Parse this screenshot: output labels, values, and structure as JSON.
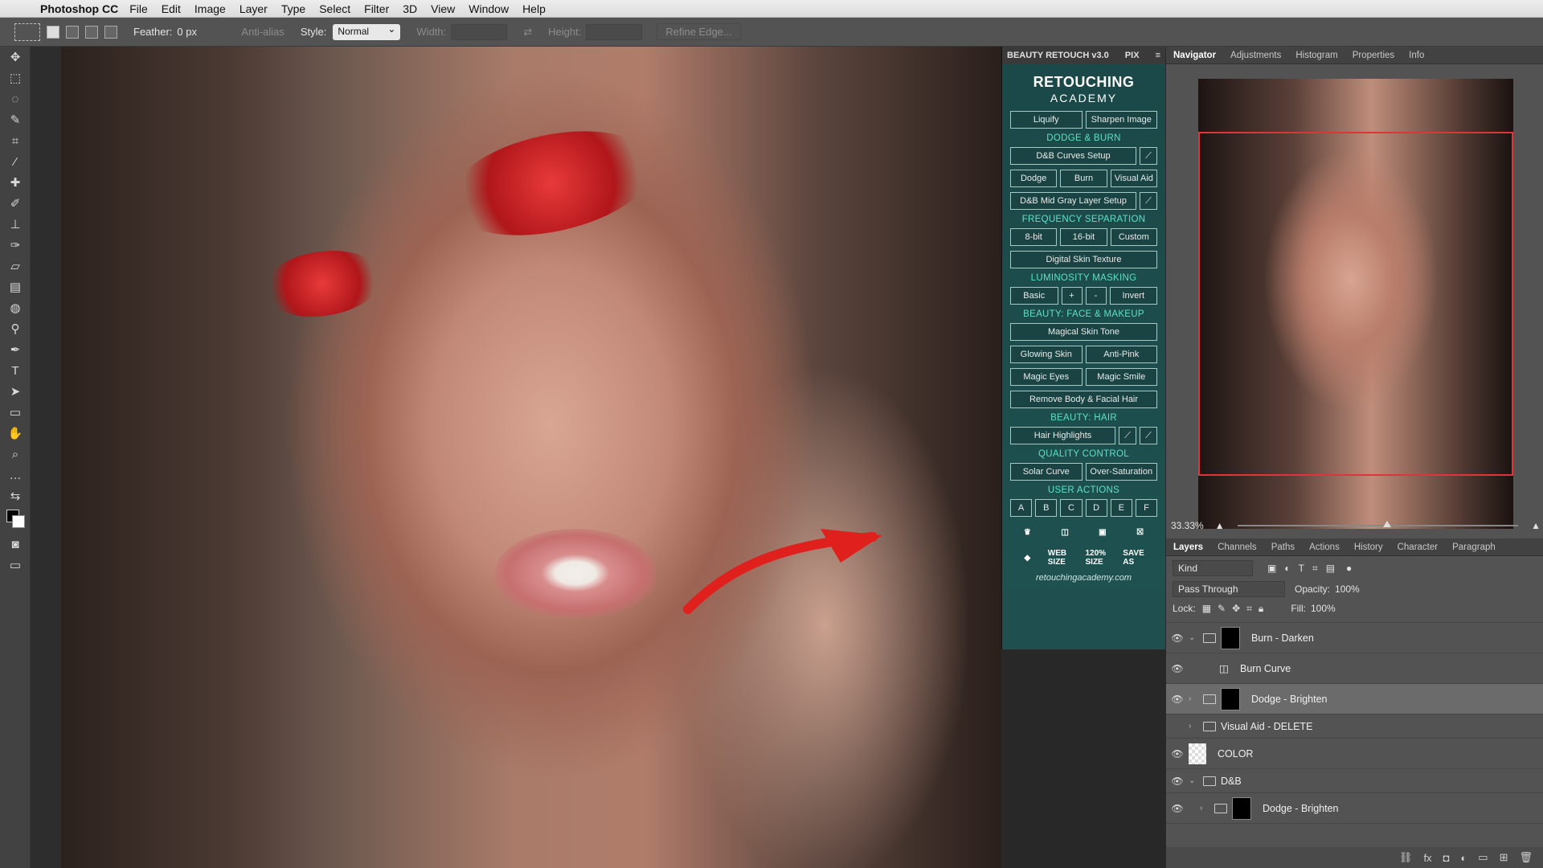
{
  "menubar": {
    "apple": "",
    "app": "Photoshop CC",
    "items": [
      "File",
      "Edit",
      "Image",
      "Layer",
      "Type",
      "Select",
      "Filter",
      "3D",
      "View",
      "Window",
      "Help"
    ]
  },
  "options": {
    "feather_label": "Feather:",
    "feather_value": "0 px",
    "antialias": "Anti-alias",
    "style_label": "Style:",
    "style_value": "Normal",
    "width_label": "Width:",
    "height_label": "Height:",
    "refine": "Refine Edge..."
  },
  "plugin": {
    "title": "BEAUTY RETOUCH v3.0",
    "pix": "PIX",
    "logo_top": "RETOUCHING",
    "logo_bottom": "ACADEMY",
    "top_buttons": [
      "Liquify",
      "Sharpen Image"
    ],
    "dodge_burn": {
      "heading": "DODGE & BURN",
      "curves": "D&B Curves Setup",
      "dodge": "Dodge",
      "burn": "Burn",
      "visual": "Visual Aid",
      "midgray": "D&B Mid Gray Layer Setup"
    },
    "freq": {
      "heading": "FREQUENCY SEPARATION",
      "b8": "8-bit",
      "b16": "16-bit",
      "custom": "Custom",
      "texture": "Digital Skin Texture"
    },
    "lum": {
      "heading": "LUMINOSITY MASKING",
      "basic": "Basic",
      "plus": "+",
      "minus": "-",
      "invert": "Invert"
    },
    "face": {
      "heading": "BEAUTY: FACE & MAKEUP",
      "skin_tone": "Magical Skin Tone",
      "glowing": "Glowing Skin",
      "antipink": "Anti-Pink",
      "eyes": "Magic Eyes",
      "smile": "Magic Smile",
      "hair_removal": "Remove Body & Facial Hair"
    },
    "hair": {
      "heading": "BEAUTY: HAIR",
      "highlights": "Hair Highlights"
    },
    "qc": {
      "heading": "QUALITY CONTROL",
      "solar": "Solar Curve",
      "oversat": "Over-Saturation"
    },
    "user": {
      "heading": "USER ACTIONS",
      "letters": [
        "A",
        "B",
        "C",
        "D",
        "E",
        "F"
      ],
      "web": "WEB SIZE",
      "size120": "120% SIZE",
      "save": "SAVE AS"
    },
    "site": "retouchingacademy.com"
  },
  "navigator": {
    "tabs": [
      "Navigator",
      "Adjustments",
      "Histogram",
      "Properties",
      "Info"
    ],
    "zoom": "33.33%",
    "zoom_fraction": 0.52
  },
  "layers": {
    "tabs": [
      "Layers",
      "Channels",
      "Paths",
      "Actions",
      "History",
      "Character",
      "Paragraph"
    ],
    "kind": "Kind",
    "blend": "Pass Through",
    "opacity_label": "Opacity:",
    "opacity_value": "100%",
    "lock_label": "Lock:",
    "fill_label": "Fill:",
    "fill_value": "100%",
    "items": [
      {
        "name": "Burn - Darken"
      },
      {
        "name": "Burn Curve"
      },
      {
        "name": "Dodge - Brighten"
      },
      {
        "name": "Visual Aid - DELETE"
      },
      {
        "name": "COLOR"
      },
      {
        "name": "D&B"
      },
      {
        "name": "Dodge - Brighten"
      }
    ]
  },
  "colors": {
    "plugin_bg": "#1f4f4f",
    "plugin_heading": "#5fe0c8",
    "nav_frame": "#e03535",
    "arrow": "#e0201d"
  }
}
